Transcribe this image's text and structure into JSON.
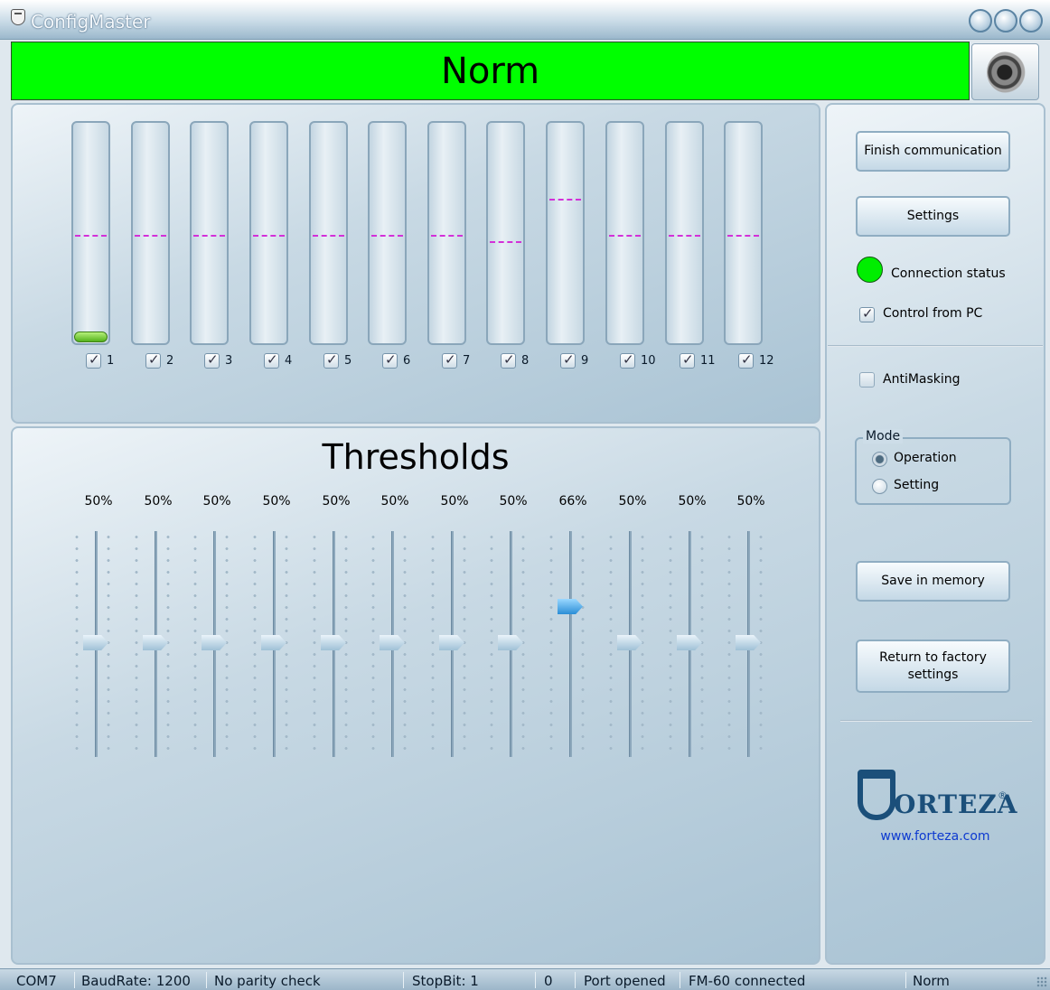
{
  "window": {
    "title": "ConfigMaster"
  },
  "banner": {
    "status_text": "Norm",
    "color": "#00ff00"
  },
  "meters": [
    {
      "label": "1",
      "checked": true,
      "level": 0.05,
      "marker": 0.5
    },
    {
      "label": "2",
      "checked": true,
      "level": 0,
      "marker": 0.5
    },
    {
      "label": "3",
      "checked": true,
      "level": 0,
      "marker": 0.5
    },
    {
      "label": "4",
      "checked": true,
      "level": 0,
      "marker": 0.5
    },
    {
      "label": "5",
      "checked": true,
      "level": 0,
      "marker": 0.5
    },
    {
      "label": "6",
      "checked": true,
      "level": 0,
      "marker": 0.5
    },
    {
      "label": "7",
      "checked": true,
      "level": 0,
      "marker": 0.5
    },
    {
      "label": "8",
      "checked": true,
      "level": 0,
      "marker": 0.47
    },
    {
      "label": "9",
      "checked": true,
      "level": 0,
      "marker": 0.66
    },
    {
      "label": "10",
      "checked": true,
      "level": 0,
      "marker": 0.5
    },
    {
      "label": "11",
      "checked": true,
      "level": 0,
      "marker": 0.5
    },
    {
      "label": "12",
      "checked": true,
      "level": 0,
      "marker": 0.5
    }
  ],
  "thresholds": {
    "title": "Thresholds",
    "values": [
      "50%",
      "50%",
      "50%",
      "50%",
      "50%",
      "50%",
      "50%",
      "50%",
      "66%",
      "50%",
      "50%",
      "50%"
    ],
    "levels": [
      0.5,
      0.5,
      0.5,
      0.5,
      0.5,
      0.5,
      0.5,
      0.5,
      0.66,
      0.5,
      0.5,
      0.5
    ]
  },
  "controls": {
    "finish_label": "Finish communication",
    "settings_label": "Settings",
    "connection_status_label": "Connection status",
    "control_from_pc_label": "Control from PC",
    "control_from_pc_checked": true,
    "antimasking_label": "AntiMasking",
    "antimasking_checked": false,
    "mode_label": "Mode",
    "mode_operation_label": "Operation",
    "mode_setting_label": "Setting",
    "mode_selected": "Operation",
    "save_label": "Save in memory",
    "factory_label_line1": "Return to factory",
    "factory_label_line2": "settings",
    "connection_color": "#00ee00"
  },
  "branding": {
    "logo_text": "ORTEZA",
    "logo_letter": "F",
    "url": "www.forteza.com"
  },
  "statusbar": {
    "port": "COM7",
    "baud": "BaudRate: 1200",
    "parity": "No parity check",
    "stopbit": "StopBit: 1",
    "count": "0",
    "port_state": "Port opened",
    "device": "FM-60 connected",
    "state": "Norm"
  }
}
